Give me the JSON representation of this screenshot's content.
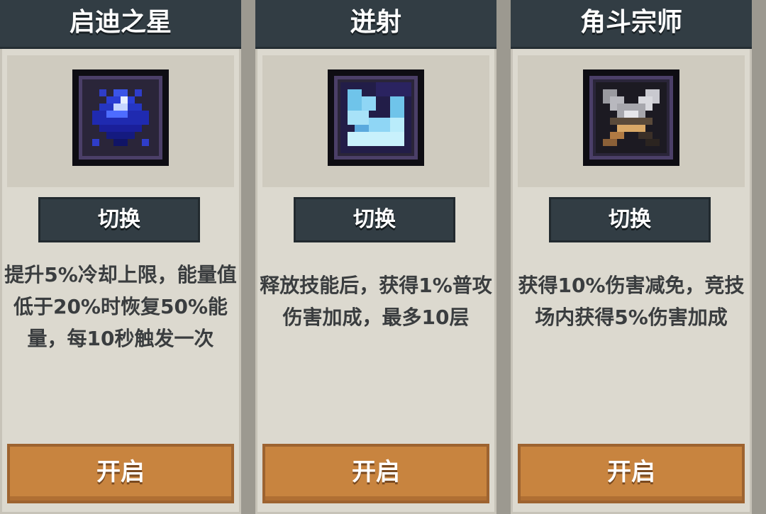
{
  "cards": [
    {
      "title": "启迪之星",
      "icon": "blue-crystal-star-icon",
      "switch_label": "切换",
      "description": "提升5%冷却上限，能量值低于20%时恢复50%能量，每10秒触发一次",
      "enable_label": "开启"
    },
    {
      "title": "迸射",
      "icon": "ice-burst-icon",
      "switch_label": "切换",
      "description": "释放技能后，获得1%普攻伤害加成，最多10层",
      "enable_label": "开启"
    },
    {
      "title": "角斗宗师",
      "icon": "crossed-swords-icon",
      "switch_label": "切换",
      "description": "获得10%伤害减免，竞技场内获得5%伤害加成",
      "enable_label": "开启"
    }
  ],
  "colors": {
    "header_bg": "#323d44",
    "card_bg": "#dcd9cf",
    "enable_button": "#c8843f",
    "text_dark": "#3a3d3f"
  }
}
